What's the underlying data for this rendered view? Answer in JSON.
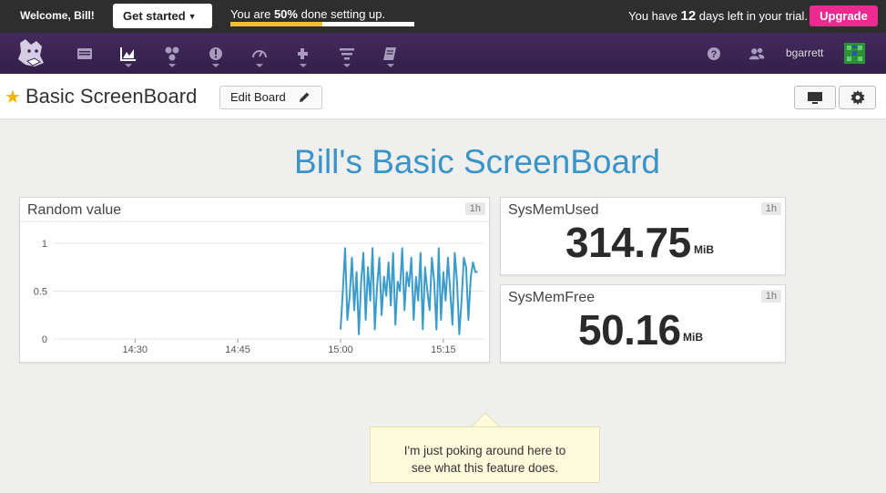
{
  "trial_bar": {
    "welcome": "Welcome, Bill!",
    "get_started": "Get started",
    "setup_prefix": "You are ",
    "setup_percent": "50%",
    "setup_suffix": " done setting up.",
    "setup_progress": 0.5,
    "trial_prefix": "You have ",
    "trial_days": "12",
    "trial_suffix": " days left in your trial.",
    "upgrade": "Upgrade"
  },
  "navbar": {
    "icons": [
      "dashboards-icon",
      "metrics-icon",
      "integrations-icon",
      "monitors-icon",
      "apm-icon",
      "infrastructure-icon",
      "logs-icon",
      "notebooks-icon"
    ],
    "help_icon": "help-icon",
    "team_icon": "team-icon",
    "username": "bgarrett"
  },
  "board": {
    "title": "Basic ScreenBoard",
    "edit_button": "Edit Board"
  },
  "screen_title": "Bill's Basic ScreenBoard",
  "widgets": {
    "timeseries": {
      "title": "Random value",
      "timeframe": "1h"
    },
    "mem_used": {
      "title": "SysMemUsed",
      "timeframe": "1h",
      "value": "314.75",
      "unit": "MiB"
    },
    "mem_free": {
      "title": "SysMemFree",
      "timeframe": "1h",
      "value": "50.16",
      "unit": "MiB"
    }
  },
  "chart_data": {
    "type": "line",
    "title": "Random value",
    "x_ticks": [
      "14:30",
      "14:45",
      "15:00",
      "15:15"
    ],
    "y_ticks": [
      "0",
      "0.5",
      "1"
    ],
    "ylim": [
      0,
      1
    ],
    "color": "#3b9ccc",
    "series": [
      {
        "x": [
          "15:00",
          "15:00",
          "15:01",
          "15:01",
          "15:01",
          "15:02",
          "15:02",
          "15:02",
          "15:03",
          "15:03",
          "15:03",
          "15:04",
          "15:04",
          "15:04",
          "15:05",
          "15:05",
          "15:05",
          "15:06",
          "15:06",
          "15:06",
          "15:07",
          "15:07",
          "15:07",
          "15:08",
          "15:08",
          "15:08",
          "15:09",
          "15:09",
          "15:09",
          "15:10",
          "15:10",
          "15:10",
          "15:11",
          "15:11",
          "15:11",
          "15:12",
          "15:12",
          "15:12",
          "15:13",
          "15:13",
          "15:13",
          "15:14",
          "15:14",
          "15:14",
          "15:15",
          "15:15",
          "15:15",
          "15:16",
          "15:16",
          "15:16",
          "15:17",
          "15:17",
          "15:17",
          "15:18",
          "15:18",
          "15:18",
          "15:19",
          "15:19",
          "15:19",
          "15:20",
          "15:20"
        ],
        "y": [
          0.1,
          0.5,
          0.95,
          0.2,
          0.45,
          0.85,
          0.3,
          0.7,
          0.05,
          0.6,
          0.9,
          0.2,
          0.75,
          0.4,
          0.95,
          0.1,
          0.55,
          0.85,
          0.25,
          0.65,
          0.45,
          0.8,
          0.35,
          0.9,
          0.15,
          0.6,
          0.5,
          0.95,
          0.3,
          0.7,
          0.55,
          0.85,
          0.2,
          0.65,
          0.4,
          0.9,
          0.1,
          0.75,
          0.5,
          0.3,
          0.85,
          0.6,
          0.1,
          0.95,
          0.2,
          0.7,
          0.4,
          0.85,
          0.5,
          0.15,
          0.9,
          0.6,
          0.05,
          0.4,
          0.85,
          0.75,
          0.2,
          0.65,
          0.8,
          0.7,
          0.7
        ]
      }
    ]
  }
}
